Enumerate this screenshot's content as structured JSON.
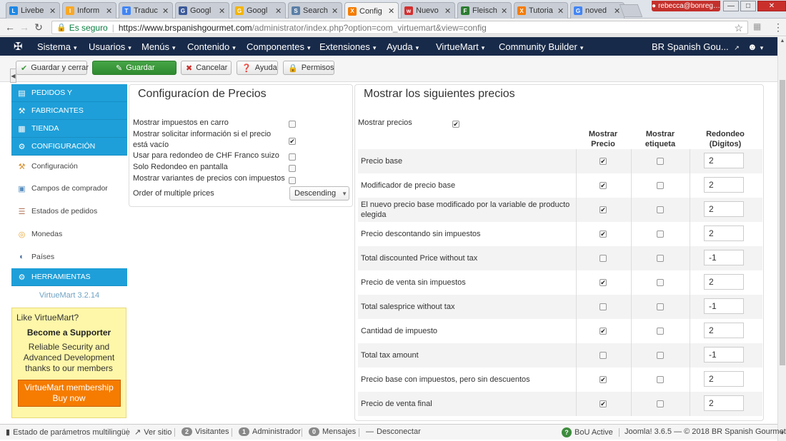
{
  "browser": {
    "tabs": [
      {
        "label": "Livebe",
        "favicon_color": "#1e88e5",
        "favicon_char": "L"
      },
      {
        "label": "Inform",
        "favicon_color": "#f9a825",
        "favicon_char": "I"
      },
      {
        "label": "Traduc",
        "favicon_color": "#4285f4",
        "favicon_char": "T"
      },
      {
        "label": "Googl",
        "favicon_color": "#3b5998",
        "favicon_char": "G"
      },
      {
        "label": "Googl",
        "favicon_color": "#f4b400",
        "favicon_char": "G"
      },
      {
        "label": "Search",
        "favicon_color": "#5b7fa6",
        "favicon_char": "S"
      },
      {
        "label": "Config",
        "favicon_color": "#f57c00",
        "favicon_char": "X"
      },
      {
        "label": "Nuevo",
        "favicon_color": "#d32f2f",
        "favicon_char": "w"
      },
      {
        "label": "Fleisch",
        "favicon_color": "#2e7d32",
        "favicon_char": "F"
      },
      {
        "label": "Tutoria",
        "favicon_color": "#f57c00",
        "favicon_char": "X"
      },
      {
        "label": "noved",
        "favicon_color": "#4285f4",
        "favicon_char": "G"
      }
    ],
    "active_tab_index": 6,
    "user_label": "rebecca@bonreg…",
    "secure_label": "Es seguro",
    "url_main": "https://www.brspanishgourmet.com",
    "url_rest": "/administrator/index.php?option=com_virtuemart&view=config"
  },
  "joomla_nav": {
    "items": [
      "Sistema",
      "Usuarios",
      "Menús",
      "Contenido",
      "Componentes",
      "Extensiones",
      "Ayuda",
      "VirtueMart",
      "Community Builder"
    ],
    "site_name": "BR Spanish Gou..."
  },
  "toolbar": {
    "save_close": "Guardar y cerrar",
    "save": "Guardar",
    "cancel": "Cancelar",
    "help": "Ayuda",
    "permissions": "Permisos"
  },
  "sidebar": {
    "items": [
      {
        "label": "PEDIDOS Y",
        "type": "section",
        "icon": "orders-icon"
      },
      {
        "label": "FABRICANTES",
        "type": "section",
        "icon": "wrench-icon"
      },
      {
        "label": "TIENDA",
        "type": "section",
        "icon": "store-icon"
      },
      {
        "label": "CONFIGURACIÓN",
        "type": "section",
        "icon": "config-icon"
      },
      {
        "label": "Configuración",
        "type": "sub",
        "icon": "tools-icon"
      },
      {
        "label": "Campos de comprador",
        "type": "sub",
        "icon": "fields-icon"
      },
      {
        "label": "Estados de pedidos",
        "type": "sub",
        "icon": "document-icon"
      },
      {
        "label": "Monedas",
        "type": "sub",
        "icon": "coins-icon"
      },
      {
        "label": "Países",
        "type": "sub",
        "icon": "globe-icon"
      },
      {
        "label": "HERRAMIENTAS",
        "type": "section",
        "icon": "tools-section-icon"
      }
    ],
    "version": "VirtueMart 3.2.14",
    "supporter": {
      "like": "Like VirtueMart?",
      "become": "Become a Supporter",
      "line1": "Reliable Security and",
      "line2": "Advanced Development",
      "line3": "thanks to our members",
      "button_line1": "VirtueMart membership",
      "button_line2": "Buy now"
    }
  },
  "price_config": {
    "title": "Configuracíon de Precios",
    "options": [
      {
        "label": "Mostrar impuestos en carro",
        "checked": false
      },
      {
        "label": "Mostrar solicitar información si el precio está vacío",
        "checked": true
      },
      {
        "label": "Usar para redondeo de CHF Franco suizo",
        "checked": false
      },
      {
        "label": "Solo Redondeo en pantalla",
        "checked": false
      },
      {
        "label": "Mostrar variantes de precios con impuestos",
        "checked": false
      }
    ],
    "order_label": "Order of multiple prices",
    "order_value": "Descending"
  },
  "show_prices": {
    "title": "Mostrar los siguientes precios",
    "show_label": "Mostrar precios",
    "show_checked": true,
    "col_price": "Mostrar Precio",
    "col_label": "Mostrar etiqueta",
    "col_round": "Redondeo (Digitos)",
    "rows": [
      {
        "label": "Precio base",
        "price": true,
        "tag": false,
        "round": "2"
      },
      {
        "label": "Modificador de precio base",
        "price": true,
        "tag": false,
        "round": "2"
      },
      {
        "label": "El nuevo precio base modificado por la variable de producto elegida",
        "price": true,
        "tag": false,
        "round": "2"
      },
      {
        "label": "Precio descontando sin impuestos",
        "price": true,
        "tag": false,
        "round": "2"
      },
      {
        "label": "Total discounted Price without tax",
        "price": false,
        "tag": false,
        "round": "-1"
      },
      {
        "label": "Precio de venta sin impuestos",
        "price": true,
        "tag": false,
        "round": "2"
      },
      {
        "label": "Total salesprice without tax",
        "price": false,
        "tag": false,
        "round": "-1"
      },
      {
        "label": "Cantidad de impuesto",
        "price": true,
        "tag": false,
        "round": "2"
      },
      {
        "label": "Total tax amount",
        "price": false,
        "tag": false,
        "round": "-1"
      },
      {
        "label": "Precio base con impuestos, pero sin descuentos",
        "price": true,
        "tag": false,
        "round": "2"
      },
      {
        "label": "Precio de venta final",
        "price": true,
        "tag": false,
        "round": "2"
      }
    ]
  },
  "statusbar": {
    "multilang": "Estado de parámetros multilingüe",
    "view_site": "Ver sitio",
    "visitors_count": "2",
    "visitors": "Visitantes",
    "admin_count": "1",
    "admin": "Administrador",
    "messages_count": "0",
    "messages": "Mensajes",
    "logout": "Desconectar",
    "bou": "BoU Active",
    "footer": "Joomla! 3.6.5 — © 2018 BR Spanish Gourmet"
  },
  "colors": {
    "nav_bg": "#182a49",
    "sidebar_blue": "#1e9fd9",
    "save_green": "#3d9a3d",
    "membership_orange": "#f57c00"
  }
}
